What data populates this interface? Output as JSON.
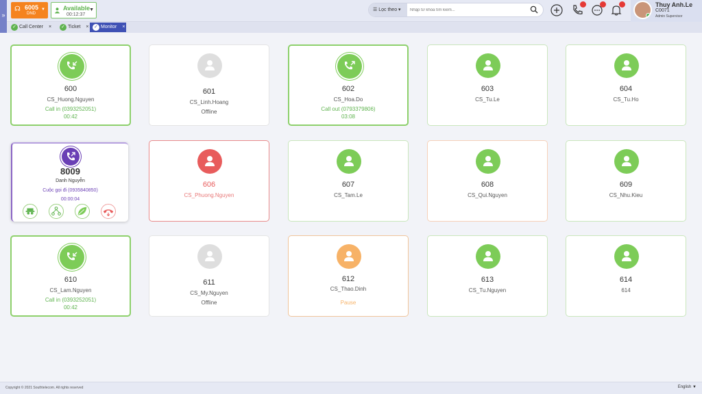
{
  "topbar": {
    "extension": {
      "number": "6005",
      "status": "DND"
    },
    "agent_status": {
      "label": "Available",
      "timer": "00:12:37"
    },
    "search": {
      "filter_label": "Lọc theo",
      "placeholder": "Nhập từ khóa tìm kiếm..."
    },
    "user": {
      "name": "Thuy Anh.Le",
      "code": "C0071",
      "role": "Admin Supervisor"
    }
  },
  "tabs": [
    {
      "label": "Call Center"
    },
    {
      "label": "Ticket"
    },
    {
      "label": "Monitor"
    }
  ],
  "colors": {
    "green": "#7dcc58",
    "gray": "#dedede",
    "red": "#e85c5c",
    "orange": "#f7b267",
    "purple": "#6a3fb5"
  },
  "agents": [
    {
      "ext": "600",
      "name": "CS_Huong.Nguyen",
      "line3": "Call in (0393252051)",
      "line4": "00:42",
      "state": "call-in"
    },
    {
      "ext": "601",
      "name": "CS_Linh.Hoang",
      "line3": "Offline",
      "line4": "",
      "state": "offline"
    },
    {
      "ext": "602",
      "name": "CS_Hoa.Do",
      "line3": "Call out (0793379806)",
      "line4": "03:08",
      "state": "call-out"
    },
    {
      "ext": "603",
      "name": "CS_Tu.Le",
      "line3": "",
      "line4": "",
      "state": "available"
    },
    {
      "ext": "604",
      "name": "CS_Tu.Ho",
      "line3": "",
      "line4": "",
      "state": "available"
    },
    {
      "ext": "8009",
      "name": "Danh Nguyễn",
      "line3": "Cuộc gọi đi (0935840850)",
      "line4": "00:00:04",
      "state": "outgoing-special"
    },
    {
      "ext": "606",
      "name": "CS_Phuong.Nguyen",
      "line3": "",
      "line4": "",
      "state": "busy"
    },
    {
      "ext": "607",
      "name": "CS_Tam.Le",
      "line3": "",
      "line4": "",
      "state": "available"
    },
    {
      "ext": "608",
      "name": "CS_Qui.Nguyen",
      "line3": "",
      "line4": "",
      "state": "available"
    },
    {
      "ext": "609",
      "name": "CS_Nhu.Kieu",
      "line3": "",
      "line4": "",
      "state": "available"
    },
    {
      "ext": "610",
      "name": "CS_Lam.Nguyen",
      "line3": "Call in (0393252051)",
      "line4": "00:42",
      "state": "call-in"
    },
    {
      "ext": "611",
      "name": "CS_My.Nguyen",
      "line3": "Offline",
      "line4": "",
      "state": "offline"
    },
    {
      "ext": "612",
      "name": "CS_Thao.Dinh",
      "line3": "Pause",
      "line4": "",
      "state": "pause"
    },
    {
      "ext": "613",
      "name": "CS_Tu.Nguyen",
      "line3": "",
      "line4": "",
      "state": "available"
    },
    {
      "ext": "614",
      "name": "614",
      "line3": "",
      "line4": "",
      "state": "available"
    }
  ],
  "footer": {
    "copyright": "Copyright © 2021 Southtelecom. All rights reserved",
    "language": "English"
  }
}
